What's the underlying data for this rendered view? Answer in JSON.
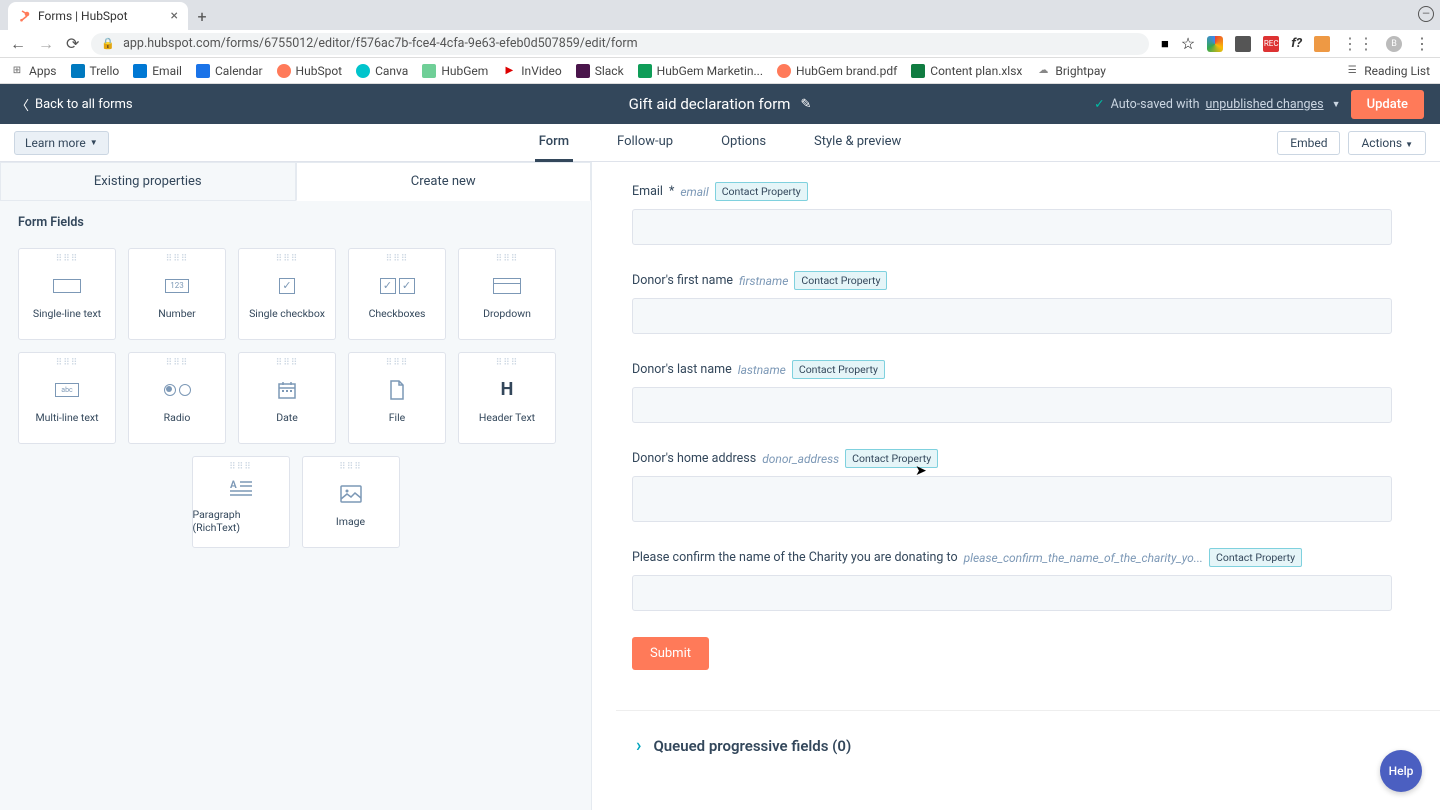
{
  "browser": {
    "tab_title": "Forms | HubSpot",
    "url": "app.hubspot.com/forms/6755012/editor/f576ac7b-fce4-4cfa-9e63-efeb0d507859/edit/form",
    "bookmarks": [
      "Apps",
      "Trello",
      "Email",
      "Calendar",
      "HubSpot",
      "Canva",
      "HubGem",
      "InVideo",
      "Slack",
      "HubGem Marketin...",
      "HubGem brand.pdf",
      "Content plan.xlsx",
      "Brightpay"
    ],
    "reading_list": "Reading List"
  },
  "header": {
    "back": "Back to all forms",
    "title": "Gift aid declaration form",
    "autosave_prefix": "Auto-saved with ",
    "autosave_link": "unpublished changes",
    "update": "Update"
  },
  "subnav": {
    "learn_more": "Learn more",
    "tabs": [
      "Form",
      "Follow-up",
      "Options",
      "Style & preview"
    ],
    "embed": "Embed",
    "actions": "Actions"
  },
  "left": {
    "tabs": {
      "existing": "Existing properties",
      "create": "Create new"
    },
    "section": "Form Fields",
    "fields": [
      {
        "id": "single-line",
        "label": "Single-line text"
      },
      {
        "id": "number",
        "label": "Number"
      },
      {
        "id": "single-checkbox",
        "label": "Single checkbox"
      },
      {
        "id": "checkboxes",
        "label": "Checkboxes"
      },
      {
        "id": "dropdown",
        "label": "Dropdown"
      },
      {
        "id": "multi-line",
        "label": "Multi-line text"
      },
      {
        "id": "radio",
        "label": "Radio"
      },
      {
        "id": "date",
        "label": "Date"
      },
      {
        "id": "file",
        "label": "File"
      },
      {
        "id": "header",
        "label": "Header Text"
      },
      {
        "id": "paragraph",
        "label": "Paragraph (RichText)"
      },
      {
        "id": "image",
        "label": "Image"
      }
    ]
  },
  "form": {
    "badge": "Contact Property",
    "fields": [
      {
        "label": "Email",
        "required": true,
        "code": "email"
      },
      {
        "label": "Donor's first name",
        "required": false,
        "code": "firstname"
      },
      {
        "label": "Donor's last name",
        "required": false,
        "code": "lastname"
      },
      {
        "label": "Donor's home address",
        "required": false,
        "code": "donor_address",
        "tall": true
      },
      {
        "label": "Please confirm the name of the Charity you are donating to",
        "required": false,
        "code": "please_confirm_the_name_of_the_charity_yo..."
      }
    ],
    "submit": "Submit",
    "queued": "Queued progressive fields (0)"
  },
  "help": "Help"
}
